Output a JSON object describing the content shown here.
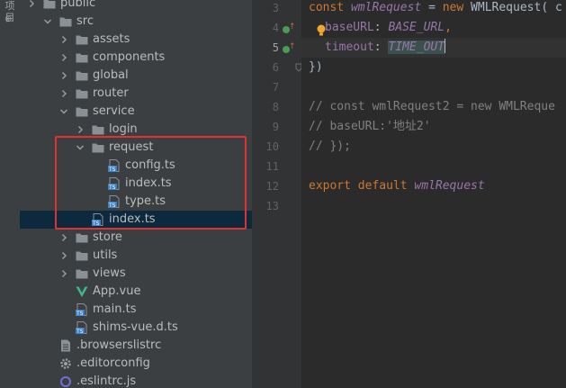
{
  "sidebar_strip": {
    "vertical_text": "项目"
  },
  "tree": {
    "items": [
      {
        "label": "public",
        "kind": "folder",
        "arrow": "right"
      },
      {
        "label": "src",
        "kind": "folder",
        "arrow": "down"
      },
      {
        "label": "assets",
        "kind": "folder",
        "arrow": "right"
      },
      {
        "label": "components",
        "kind": "folder",
        "arrow": "right"
      },
      {
        "label": "global",
        "kind": "folder",
        "arrow": "right"
      },
      {
        "label": "router",
        "kind": "folder",
        "arrow": "right"
      },
      {
        "label": "service",
        "kind": "folder",
        "arrow": "down"
      },
      {
        "label": "login",
        "kind": "folder",
        "arrow": "right"
      },
      {
        "label": "request",
        "kind": "folder",
        "arrow": "down"
      },
      {
        "label": "config.ts",
        "kind": "ts"
      },
      {
        "label": "index.ts",
        "kind": "ts"
      },
      {
        "label": "type.ts",
        "kind": "ts"
      },
      {
        "label": "index.ts",
        "kind": "ts",
        "selected": true
      },
      {
        "label": "store",
        "kind": "folder",
        "arrow": "right"
      },
      {
        "label": "utils",
        "kind": "folder",
        "arrow": "right"
      },
      {
        "label": "views",
        "kind": "folder",
        "arrow": "right"
      },
      {
        "label": "App.vue",
        "kind": "vue"
      },
      {
        "label": "main.ts",
        "kind": "ts"
      },
      {
        "label": "shims-vue.d.ts",
        "kind": "ts"
      },
      {
        "label": ".browserslistrc",
        "kind": "text"
      },
      {
        "label": ".editorconfig",
        "kind": "gear"
      },
      {
        "label": ".eslintrc.js",
        "kind": "eslint"
      }
    ]
  },
  "editor": {
    "line_numbers": [
      "3",
      "4",
      "5",
      "6",
      "7",
      "8",
      "9",
      "10",
      "11",
      "12",
      "13"
    ],
    "current_line": "5",
    "lines": {
      "l3": {
        "kw": "const ",
        "var": "wmlRequest",
        "eq": " = ",
        "new": "new ",
        "cls": "WMLRequest",
        "rest": "( c"
      },
      "l4": {
        "prop": "baseURL",
        "colon": ": ",
        "const": "BASE_URL",
        "comma": ","
      },
      "l5": {
        "prop": "timeout",
        "colon": ": ",
        "const": "TIME_OUT"
      },
      "l6": {
        "text": "})"
      },
      "l8": {
        "text": "// const wmlRequest2  = new WMLReque"
      },
      "l9": {
        "text": "//   baseURL:'地址2'"
      },
      "l10": {
        "text": "// });"
      },
      "l12": {
        "kw": "export ",
        "def": "default ",
        "var": "wmlRequest"
      }
    }
  },
  "colors": {
    "selection": "#0d293e",
    "highlight_box": "#e0332f",
    "keyword": "#cc7832",
    "variable": "#9876aa",
    "comment": "#808080"
  }
}
